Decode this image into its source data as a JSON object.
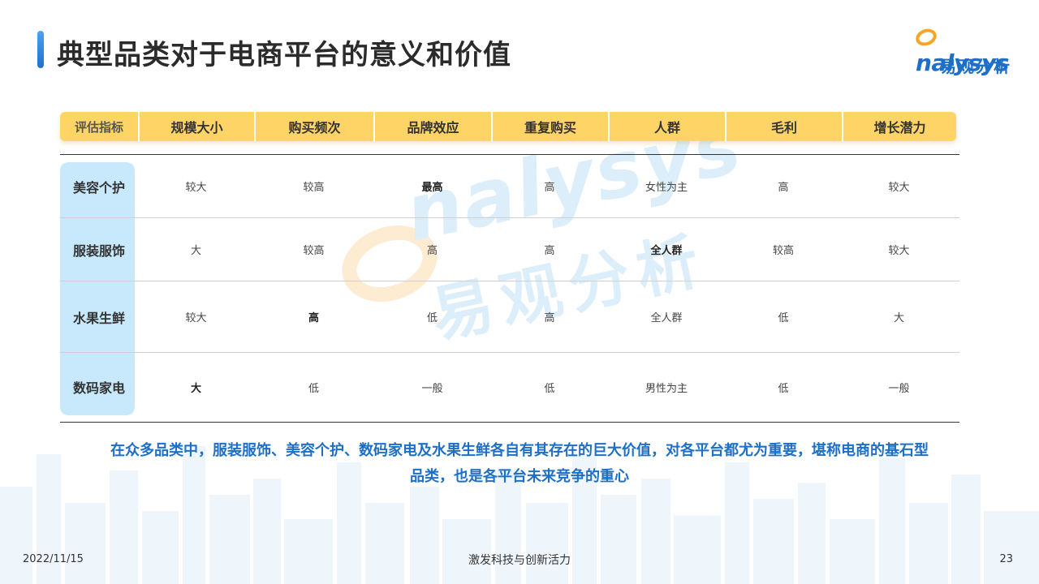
{
  "title": "典型品类对于电商平台的意义和价值",
  "logo": {
    "en": "nalysys",
    "cn": "易观分析"
  },
  "watermark": {
    "en": "nalysys",
    "cn": "易观分析"
  },
  "table": {
    "headers": [
      "评估指标",
      "规模大小",
      "购买频次",
      "品牌效应",
      "重复购买",
      "人群",
      "毛利",
      "增长潜力"
    ],
    "rows": [
      {
        "label": "美容个护",
        "values": [
          "较大",
          "较高",
          "最高",
          "高",
          "女性为主",
          "高",
          "较大"
        ],
        "bold": [
          false,
          false,
          true,
          false,
          false,
          false,
          false
        ]
      },
      {
        "label": "服装服饰",
        "values": [
          "大",
          "较高",
          "高",
          "高",
          "全人群",
          "较高",
          "较大"
        ],
        "bold": [
          false,
          false,
          false,
          false,
          true,
          false,
          false
        ]
      },
      {
        "label": "水果生鲜",
        "values": [
          "较大",
          "高",
          "低",
          "高",
          "全人群",
          "低",
          "大"
        ],
        "bold": [
          false,
          true,
          false,
          false,
          false,
          false,
          false
        ]
      },
      {
        "label": "数码家电",
        "values": [
          "大",
          "低",
          "一般",
          "低",
          "男性为主",
          "低",
          "一般"
        ],
        "bold": [
          true,
          false,
          false,
          false,
          false,
          false,
          false
        ]
      }
    ]
  },
  "summary": {
    "line1": "在众多品类中，服装服饰、美容个护、数码家电及水果生鲜各自有其存在的巨大价值，对各平台都尤为重要，堪称电商的基石型",
    "line2": "品类，也是各平台未来竞争的重心"
  },
  "footer": {
    "date": "2022/11/15",
    "slogan": "激发科技与创新活力",
    "page": "23"
  },
  "colors": {
    "accent": "#1e6fc8",
    "header_bg": "#ffd467",
    "row_label_bg": "#c8e9fb",
    "logo_orange": "#f6a524"
  }
}
